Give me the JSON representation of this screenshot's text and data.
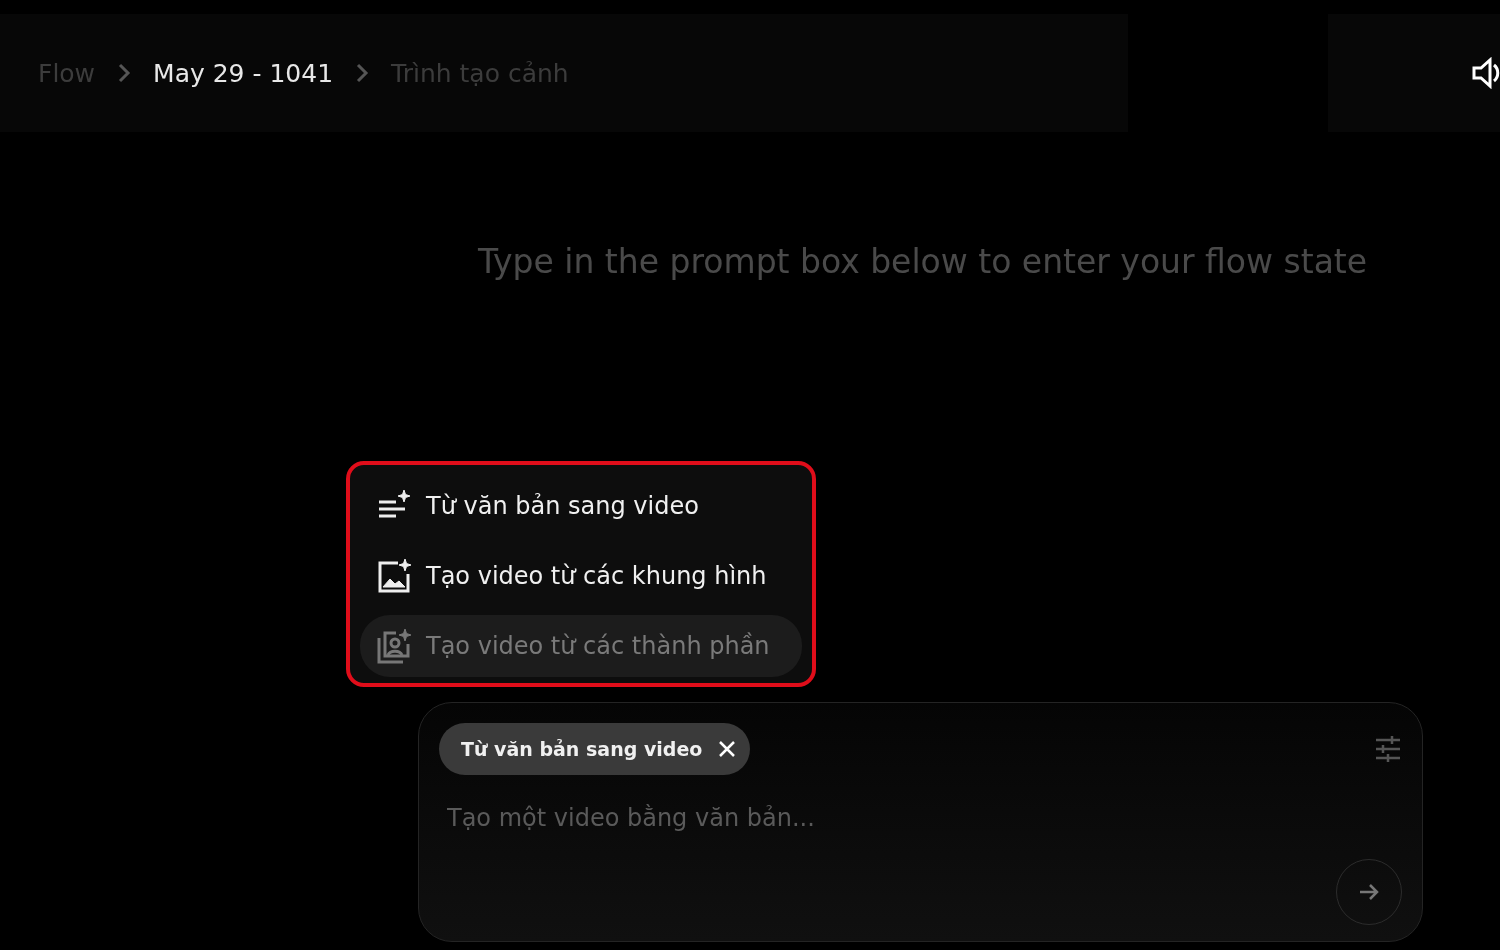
{
  "breadcrumb": [
    {
      "label": "Flow",
      "current": false
    },
    {
      "label": "May 29 - 1041",
      "current": true
    },
    {
      "label": "Trình tạo cảnh",
      "current": false
    }
  ],
  "headline": "Type in the prompt box below to enter your flow state",
  "mode_menu": {
    "highlighted": true,
    "items": [
      {
        "kind": "text",
        "label": "Từ văn bản sang video",
        "selected": false,
        "disabled": false
      },
      {
        "kind": "frames",
        "label": "Tạo video từ các khung hình",
        "selected": false,
        "disabled": false
      },
      {
        "kind": "ingredients",
        "label": "Tạo video từ các thành phần",
        "selected": true,
        "disabled": true
      }
    ]
  },
  "prompt": {
    "chip": "Từ văn bản sang video",
    "placeholder": "Tạo một video bằng văn bản..."
  }
}
